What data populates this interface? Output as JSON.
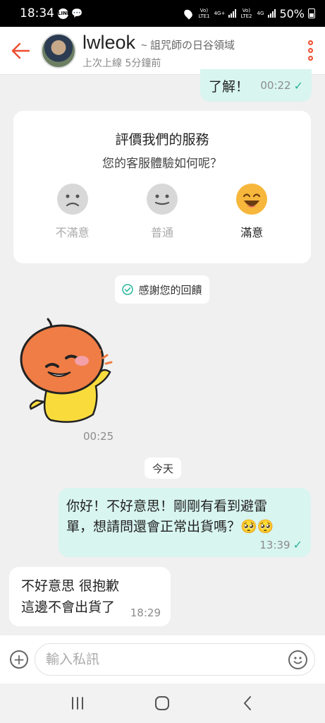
{
  "status_bar": {
    "time": "18:34",
    "app_badge": "LINE",
    "sim1": "Vo) LTE1",
    "sim1_net": "4G+",
    "sim2": "Vo) LTE2",
    "sim2_net": "4G",
    "battery": "50%"
  },
  "header": {
    "name": "lwleok",
    "shop": "~ 詛咒師の日谷領域",
    "last_seen": "上次上線 5分鐘前"
  },
  "messages": {
    "m1": {
      "text": "了解！",
      "time": "00:22"
    },
    "rating": {
      "title": "評價我們的服務",
      "subtitle": "您的客服體驗如何呢？",
      "options": [
        "不滿意",
        "普通",
        "滿意"
      ],
      "selected": "滿意"
    },
    "feedback_pill": "感謝您的回饋",
    "sticker_time": "00:25",
    "date_divider": "今天",
    "m2": {
      "line1": "你好！不好意思！剛剛有看到避雷",
      "line2": "單，想請問還會正常出貨嗎？🥺🥺",
      "time": "13:39"
    },
    "m3": {
      "line1": "不好意思 很抱歉",
      "line2": "這邊不會出貨了",
      "time": "18:29"
    }
  },
  "composer": {
    "placeholder": "輸入私訊"
  },
  "colors": {
    "accent": "#ee4d2d",
    "outgoing_bubble": "#d8f5ef",
    "tick": "#2bb59b"
  }
}
